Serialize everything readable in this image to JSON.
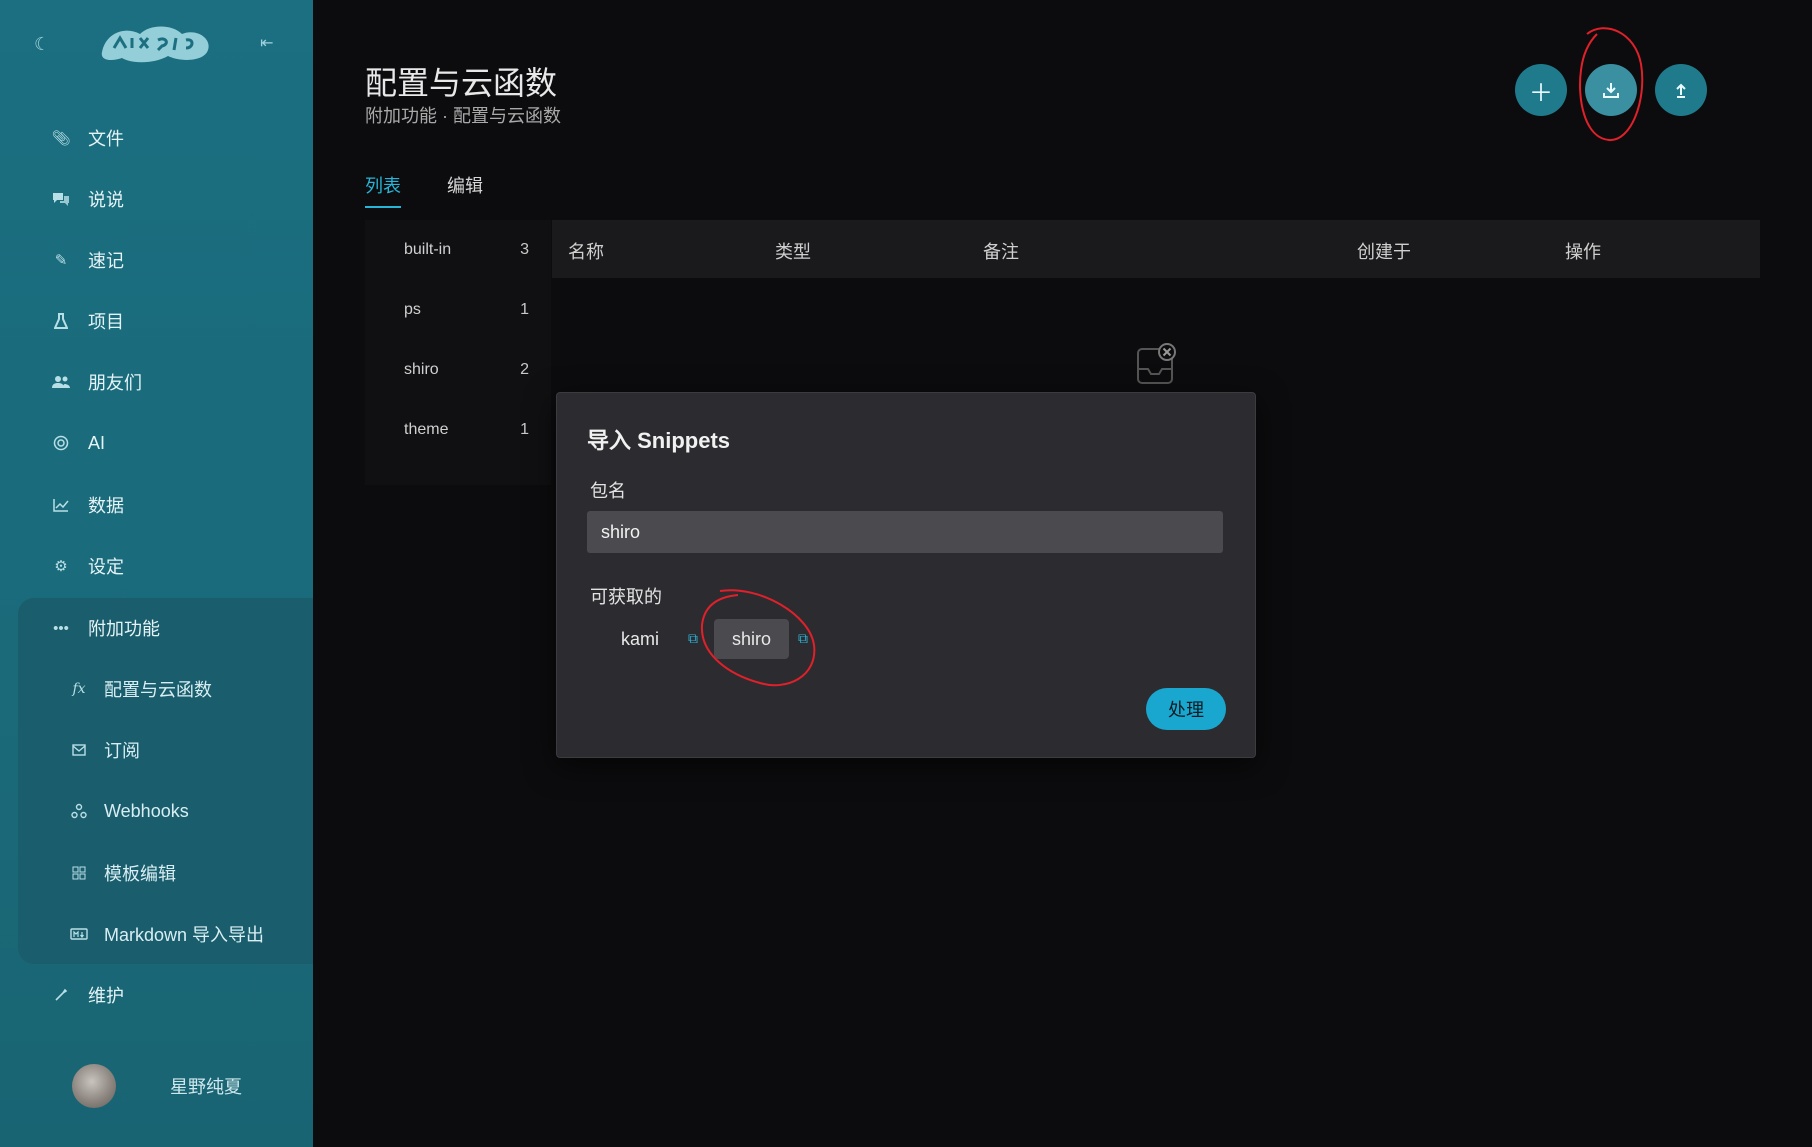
{
  "sidebar": {
    "items": [
      {
        "label": "文件",
        "icon": "paperclip-icon"
      },
      {
        "label": "说说",
        "icon": "chat-icon"
      },
      {
        "label": "速记",
        "icon": "pencil-icon"
      },
      {
        "label": "项目",
        "icon": "flask-icon"
      },
      {
        "label": "朋友们",
        "icon": "users-icon"
      },
      {
        "label": "AI",
        "icon": "ai-icon"
      },
      {
        "label": "数据",
        "icon": "chart-icon"
      },
      {
        "label": "设定",
        "icon": "gear-icon"
      },
      {
        "label": "附加功能",
        "icon": "more-icon"
      }
    ],
    "sub_items": [
      {
        "label": "配置与云函数",
        "icon": "function-icon"
      },
      {
        "label": "订阅",
        "icon": "mail-icon"
      },
      {
        "label": "Webhooks",
        "icon": "webhook-icon"
      },
      {
        "label": "模板编辑",
        "icon": "grid-icon"
      },
      {
        "label": "Markdown 导入导出",
        "icon": "markdown-icon"
      }
    ],
    "maintenance": {
      "label": "维护",
      "icon": "wrench-icon"
    },
    "user": {
      "name": "星野纯夏"
    }
  },
  "header": {
    "title": "配置与云函数",
    "breadcrumb": "附加功能 · 配置与云函数"
  },
  "tabs": [
    {
      "label": "列表"
    },
    {
      "label": "编辑"
    }
  ],
  "groups": [
    {
      "name": "built-in",
      "count": "3"
    },
    {
      "name": "ps",
      "count": "1"
    },
    {
      "name": "shiro",
      "count": "2"
    },
    {
      "name": "theme",
      "count": "1"
    }
  ],
  "table": {
    "columns": [
      "名称",
      "类型",
      "备注",
      "创建于",
      "操作"
    ]
  },
  "modal": {
    "title": "导入 Snippets",
    "package_label": "包名",
    "package_value": "shiro",
    "available_label": "可获取的",
    "options": [
      "kami",
      "shiro"
    ],
    "submit_label": "处理"
  },
  "colors": {
    "accent": "#26b5d6",
    "sidebar": "#1b6f80",
    "annotation": "#e0202a"
  }
}
